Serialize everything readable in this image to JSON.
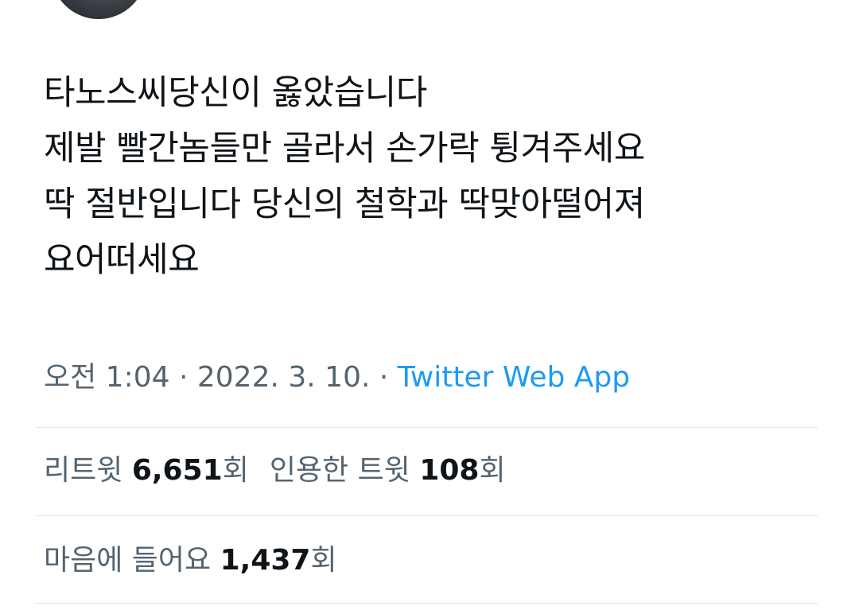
{
  "tweet": {
    "lines": [
      "타노스씨당신이 옳았습니다",
      "제발 빨간놈들만 골라서 손가락 튕겨주세요",
      "딱 절반입니다 당신의 철학과 딱맞아떨어져",
      "요어떠세요"
    ]
  },
  "meta": {
    "time": "오전 1:04",
    "sep1": " · ",
    "date": "2022. 3. 10.",
    "sep2": " · ",
    "source": "Twitter Web App"
  },
  "stats": {
    "retweets": {
      "label": "리트윗 ",
      "count": "6,651",
      "unit": "회"
    },
    "quotes": {
      "label": "인용한 트윗 ",
      "count": "108",
      "unit": "회"
    },
    "likes": {
      "label": "마음에 들어요 ",
      "count": "1,437",
      "unit": "회"
    }
  }
}
